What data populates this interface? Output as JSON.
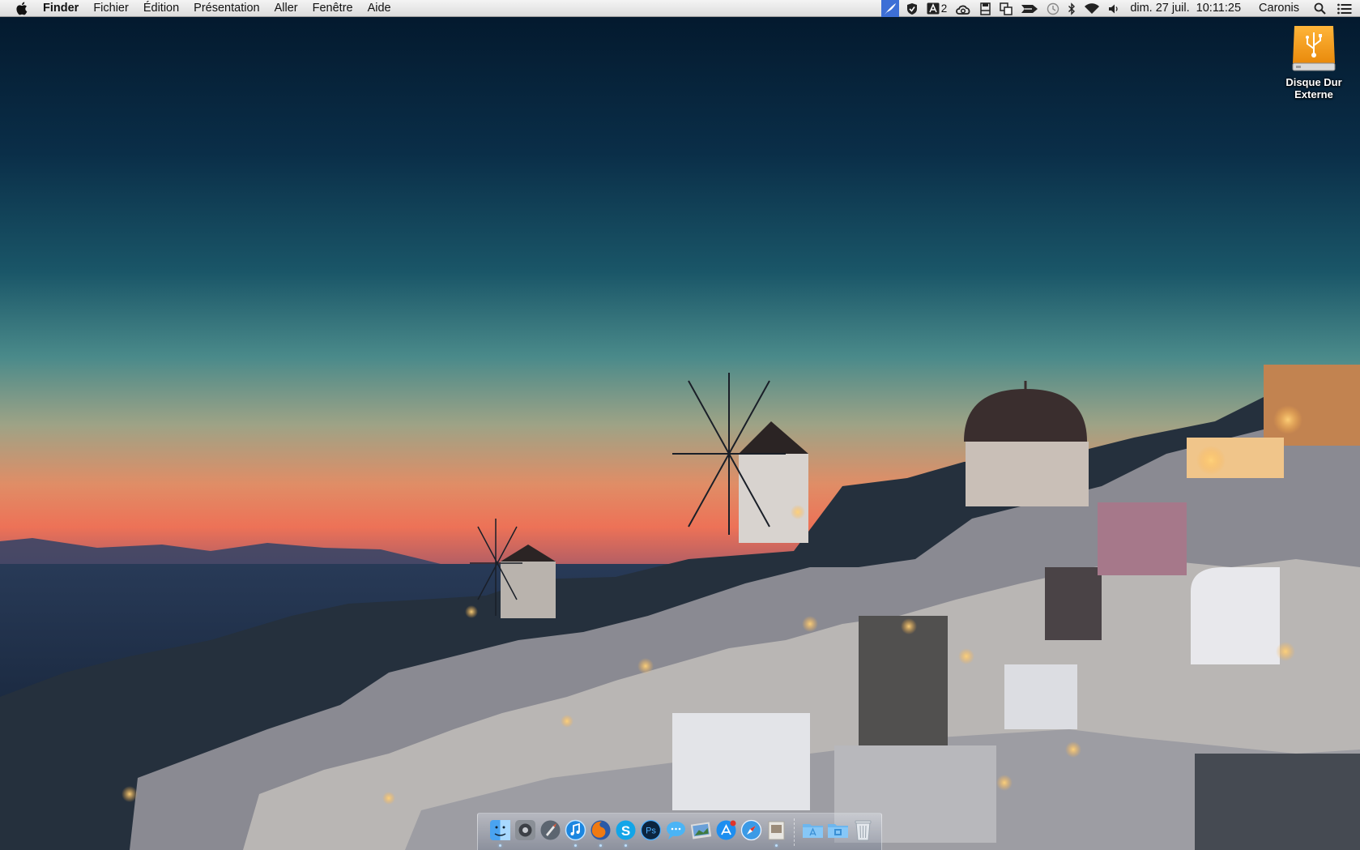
{
  "menubar": {
    "app_name": "Finder",
    "menus": [
      "Fichier",
      "Édition",
      "Présentation",
      "Aller",
      "Fenêtre",
      "Aide"
    ],
    "status": {
      "adobe_badge": "2",
      "date": "dim. 27 juil.",
      "time": "10:11:25",
      "user": "Caronis"
    }
  },
  "desktop": {
    "drive_label": "Disque Dur Externe"
  },
  "dock": {
    "apps": [
      "finder",
      "system-preferences",
      "launchpad",
      "itunes",
      "firefox",
      "skype",
      "photoshop",
      "messages",
      "iphoto",
      "app-store",
      "safari",
      "preview",
      "applications-folder",
      "downloads-folder",
      "trash"
    ]
  }
}
